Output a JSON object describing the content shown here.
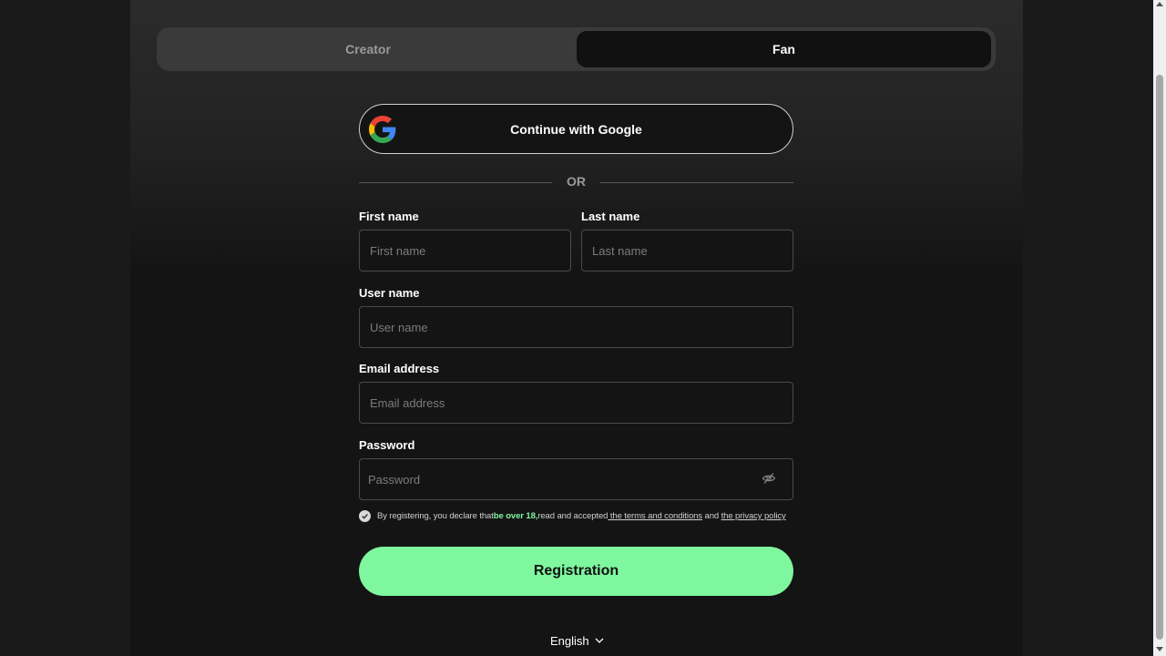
{
  "tabs": [
    {
      "label": "Creator",
      "active": false
    },
    {
      "label": "Fan",
      "active": true
    }
  ],
  "google_button": {
    "label": "Continue with Google",
    "icon": "google-icon"
  },
  "divider": {
    "label": "OR"
  },
  "form": {
    "first_name": {
      "label": "First name",
      "placeholder": "First name",
      "value": ""
    },
    "last_name": {
      "label": "Last name",
      "placeholder": "Last name",
      "value": ""
    },
    "user_name": {
      "label": "User name",
      "placeholder": "User name",
      "value": ""
    },
    "email": {
      "label": "Email address",
      "placeholder": "Email address",
      "value": ""
    },
    "password": {
      "label": "Password",
      "placeholder": "Password",
      "value": "",
      "toggle_icon": "eye-slash-icon"
    }
  },
  "consent": {
    "checked": true,
    "text_before": "By registering, you declare that",
    "highlight": "be over 18,",
    "text_middle": "read and accepted",
    "terms_link": " the terms and conditions",
    "and": " and ",
    "privacy_link": "the privacy policy"
  },
  "submit": {
    "label": "Registration"
  },
  "language": {
    "selected": "English",
    "icon": "chevron-down-icon"
  },
  "colors": {
    "accent": "#7ef79f",
    "background": "#141414",
    "tab_bg": "#3a3a3a"
  }
}
